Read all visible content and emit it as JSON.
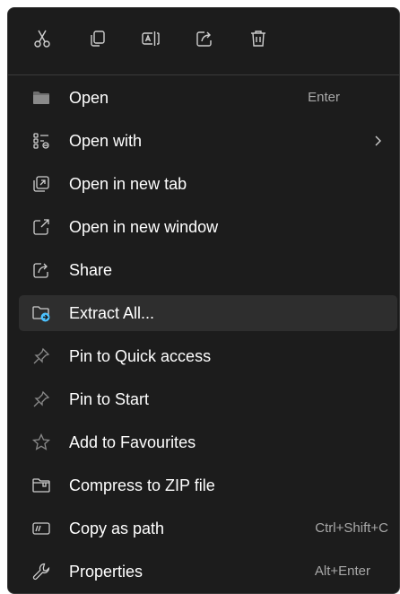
{
  "toolbar": {
    "buttons": [
      {
        "name": "cut",
        "icon": "scissors-icon"
      },
      {
        "name": "copy",
        "icon": "copy-icon"
      },
      {
        "name": "rename",
        "icon": "rename-icon"
      },
      {
        "name": "share",
        "icon": "share-icon"
      },
      {
        "name": "delete",
        "icon": "trash-icon"
      }
    ]
  },
  "menu": {
    "items": [
      {
        "label": "Open",
        "shortcut": "Enter",
        "icon": "folder-icon"
      },
      {
        "label": "Open with",
        "icon": "open-with-icon",
        "submenu": true
      },
      {
        "label": "Open in new tab",
        "icon": "new-tab-icon"
      },
      {
        "label": "Open in new window",
        "icon": "new-window-icon"
      },
      {
        "label": "Share",
        "icon": "share-icon"
      },
      {
        "label": "Extract All...",
        "icon": "extract-folder-icon",
        "highlighted": true
      },
      {
        "label": "Pin to Quick access",
        "icon": "pin-icon"
      },
      {
        "label": "Pin to Start",
        "icon": "pin-icon"
      },
      {
        "label": "Add to Favourites",
        "icon": "star-icon"
      },
      {
        "label": "Compress to ZIP file",
        "icon": "zip-folder-icon"
      },
      {
        "label": "Copy as path",
        "shortcut": "Ctrl+Shift+C",
        "icon": "copy-path-icon"
      },
      {
        "label": "Properties",
        "shortcut": "Alt+Enter",
        "icon": "wrench-icon"
      }
    ]
  },
  "colors": {
    "background": "#1c1c1c",
    "highlight": "#2e2e2e",
    "text": "#ffffff",
    "shortcut": "#a8a8a8",
    "icon": "#cfcfcf",
    "accent": "#4cc2ff"
  }
}
